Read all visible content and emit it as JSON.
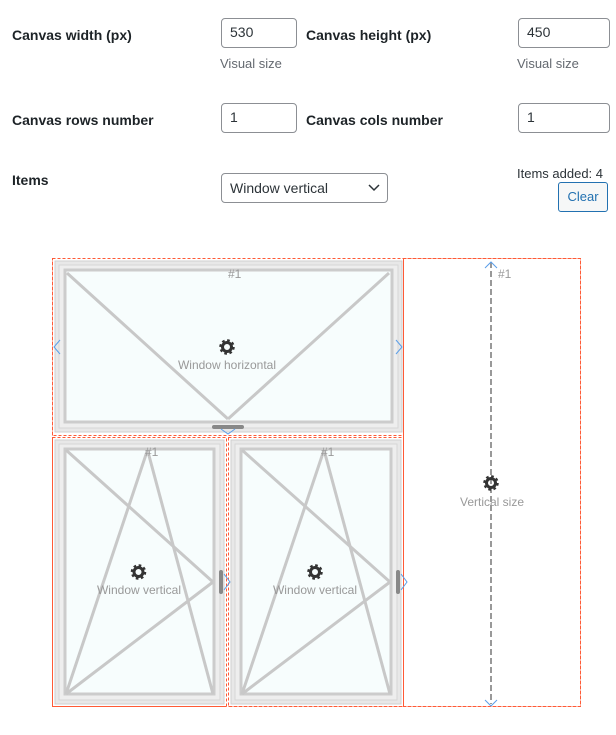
{
  "form": {
    "canvas_width_label": "Canvas width (px)",
    "canvas_width_value": "530",
    "canvas_width_hint": "Visual size",
    "canvas_height_label": "Canvas height (px)",
    "canvas_height_value": "450",
    "canvas_height_hint": "Visual size",
    "rows_label": "Canvas rows number",
    "rows_value": "1",
    "cols_label": "Canvas cols number",
    "cols_value": "1",
    "items_label": "Items",
    "items_selected": "Window vertical",
    "items_added": "Items added: 4",
    "clear_label": "Clear"
  },
  "canvas": {
    "items": [
      {
        "type": "Window horizontal",
        "number": "#1",
        "label": "Window horizontal"
      },
      {
        "type": "Window vertical",
        "number": "#1",
        "label": "Window vertical"
      },
      {
        "type": "Window vertical",
        "number": "#1",
        "label": "Window vertical"
      },
      {
        "type": "Vertical size",
        "number": "#1",
        "label": "Vertical size"
      }
    ],
    "colors": {
      "cell_border": "#ff5a36",
      "frame": "#e8e8e8",
      "glass": "#f7fdfd",
      "sash_line": "#c8c8c8",
      "arrow": "#5b9ee8",
      "gear": "#333333"
    }
  }
}
